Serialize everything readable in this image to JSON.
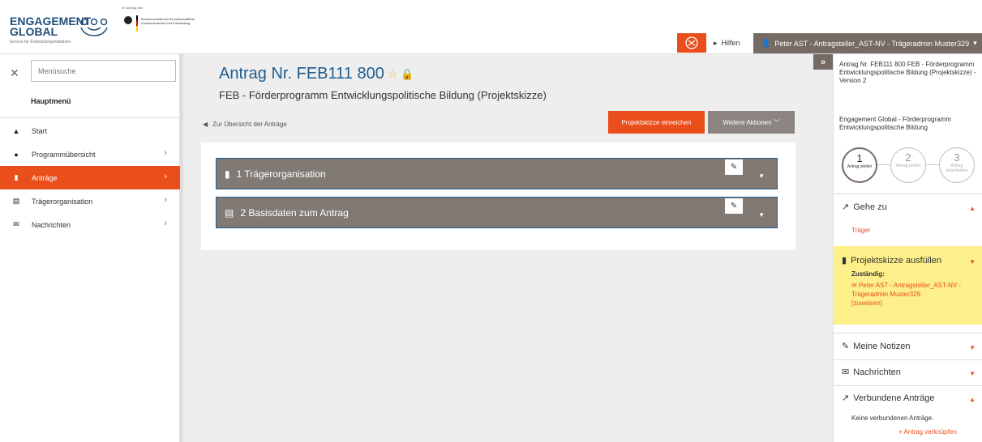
{
  "header": {
    "logo_line1": "ENGAGEMENT",
    "logo_line2": "GLOBAL",
    "logo_sub": "Service für Entwicklungsinitiativen",
    "auftrag": "Im Auftrag des",
    "bmz": "Bundesministerium für wirtschaftliche Zusammenarbeit und Entwicklung",
    "hilfen": "Hilfen",
    "user": "Peter AST - Antragsteller_AST-NV - Trägeradmin Muster329"
  },
  "sidebar": {
    "search_placeholder": "Menüsuche",
    "title": "Hauptmenü",
    "items": [
      {
        "label": "Start"
      },
      {
        "label": "Programmübersicht"
      },
      {
        "label": "Anträge"
      },
      {
        "label": "Trägerorganisation"
      },
      {
        "label": "Nachrichten"
      }
    ]
  },
  "main": {
    "title": "Antrag Nr. FEB111 800",
    "subtitle": "FEB - Förderprogramm Entwicklungspolitische Bildung (Projektskizze)",
    "back_link": "Zur Übersicht der Anträge",
    "btn_submit": "Projektskizze einreichen",
    "btn_more": "Weitere Aktionen",
    "sections": [
      {
        "label": "1 Trägerorganisation"
      },
      {
        "label": "2 Basisdaten zum Antrag"
      }
    ]
  },
  "right": {
    "info": "Antrag Nr. FEB111 800 FEB - Förderprogramm Entwicklungspolitische Bildung (Projektskizze) - Version 2",
    "org": "Engagement Global - Förderprogramm Entwicklungspolitische Bildung",
    "steps": [
      {
        "num": "1",
        "label": "Antrag stellen"
      },
      {
        "num": "2",
        "label": "Antrag prüfen"
      },
      {
        "num": "3",
        "label": "Antrag entscheiden"
      }
    ],
    "goto_title": "Gehe zu",
    "goto_link": "Träger",
    "fill_title": "Projektskizze ausfüllen",
    "zustaendig": "Zuständig:",
    "assignee": "Peter AST - Antragsteller_AST-NV - Trägeradmin Muster329",
    "assign_link": "[zuweisen]",
    "notes_title": "Meine Notizen",
    "messages_title": "Nachrichten",
    "linked_title": "Verbundene Anträge",
    "linked_empty": "Keine verbundenen Anträge.",
    "linked_link": "+ Antrag verknüpfen"
  }
}
